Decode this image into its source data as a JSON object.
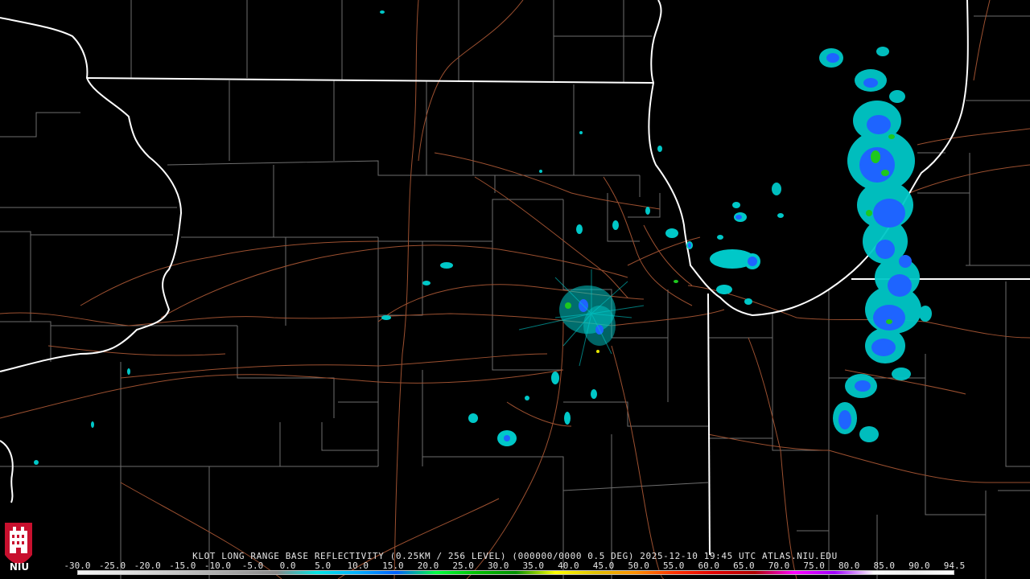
{
  "product": {
    "title": "KLOT LONG RANGE BASE REFLECTIVITY (0.25KM / 256 LEVEL) (000000/0000 0.5 DEG) 2025-12-10 19:45 UTC  ATLAS.NIU.EDU"
  },
  "scale": {
    "labels": [
      "-30.0",
      "-25.0",
      "-20.0",
      "-15.0",
      "-10.0",
      "-5.0",
      "0.0",
      "5.0",
      "10.0",
      "15.0",
      "20.0",
      "25.0",
      "30.0",
      "35.0",
      "40.0",
      "45.0",
      "50.0",
      "55.0",
      "60.0",
      "65.0",
      "70.0",
      "75.0",
      "80.0",
      "85.0",
      "90.0",
      "94.5"
    ],
    "colors": [
      "#f5f5f5",
      "#e6e6e6",
      "#d0d0d0",
      "#b8b8b8",
      "#a0a0a0",
      "#888888",
      "#00e5e5",
      "#00b0ff",
      "#0060ff",
      "#00ff40",
      "#00c000",
      "#009000",
      "#ffff00",
      "#e0c000",
      "#ff9000",
      "#ff3000",
      "#e00000",
      "#b00000",
      "#ff00ff",
      "#a000ff",
      "#ffffff",
      "#f0f0f0",
      "#ffffff"
    ]
  },
  "logo": {
    "text": "NIU"
  },
  "colors": {
    "background": "#000000",
    "county_lines": "#7a7a7a",
    "state_lines": "#ffffff",
    "highways": "#a0522d",
    "echo_light": "#00c8c8",
    "echo_mid": "#1e64ff",
    "echo_strong": "#1ec81e"
  }
}
